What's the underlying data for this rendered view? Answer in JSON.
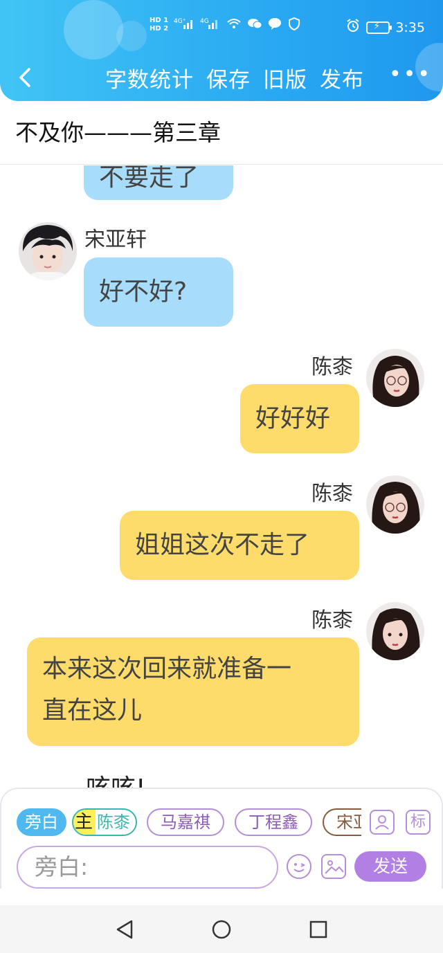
{
  "status_bar": {
    "sim_labels": [
      "HD 1",
      "HD 2"
    ],
    "net1": "4G⁺",
    "net2": "4G",
    "time": "3:35"
  },
  "header": {
    "actions": [
      "字数统计",
      "保存",
      "旧版",
      "发布"
    ],
    "more": "•••"
  },
  "chapter": {
    "title": "不及你———第三章"
  },
  "chat": {
    "top_partial_text": "不要走了",
    "messages": [
      {
        "sender": "宋亚轩",
        "text": "好不好?",
        "side": "left",
        "color": "#a8dcfb"
      },
      {
        "sender": "陈桼",
        "text": "好好好",
        "side": "right",
        "color": "#fddc6c"
      },
      {
        "sender": "陈桼",
        "text": "姐姐这次不走了",
        "side": "right",
        "color": "#fddc6c"
      },
      {
        "sender": "陈桼",
        "text_lines": [
          "本来这次回来就准备一",
          "直在这儿"
        ],
        "side": "right",
        "color": "#fddc6c"
      }
    ],
    "bottom_partial_text": "咳咳!"
  },
  "composer": {
    "chips": {
      "narration": "旁白",
      "main_tag": "主",
      "chen": "陈桼",
      "ma": "马嘉祺",
      "ding": "丁程鑫",
      "song_partial": "宋亚"
    },
    "tag_button": "标",
    "input_placeholder": "旁白:",
    "send": "发送"
  },
  "colors": {
    "header_blue": "#2aa9f2",
    "bubble_blue": "#a8dcfb",
    "bubble_yellow": "#fddc6c",
    "accent_purple": "#b27fe4"
  }
}
